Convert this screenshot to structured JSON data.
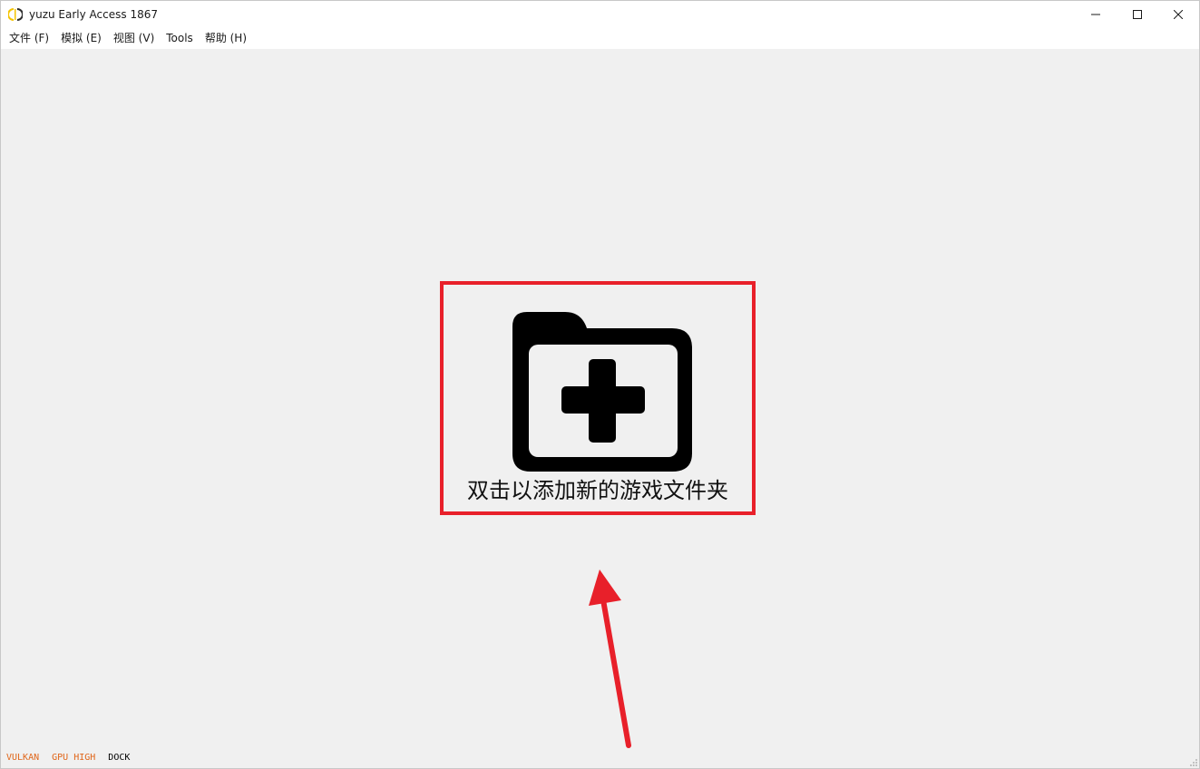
{
  "window": {
    "title": "yuzu Early Access 1867"
  },
  "menu": {
    "items": [
      {
        "label": "文件 (F)"
      },
      {
        "label": "模拟 (E)"
      },
      {
        "label": "视图 (V)"
      },
      {
        "label": "Tools"
      },
      {
        "label": "帮助 (H)"
      }
    ]
  },
  "main": {
    "add_folder_label": "双击以添加新的游戏文件夹"
  },
  "status": {
    "api": "VULKAN",
    "gpu_accuracy": "GPU HIGH",
    "mode": "DOCK"
  },
  "colors": {
    "highlight_border": "#e8202a",
    "status_orange": "#e0661a",
    "folder_icon": "#000000"
  },
  "icons": {
    "app": "yuzu-logo-icon",
    "minimize": "minimize-icon",
    "maximize": "maximize-icon",
    "close": "close-icon",
    "folder_add": "folder-add-icon",
    "arrow": "arrow-up-icon"
  }
}
